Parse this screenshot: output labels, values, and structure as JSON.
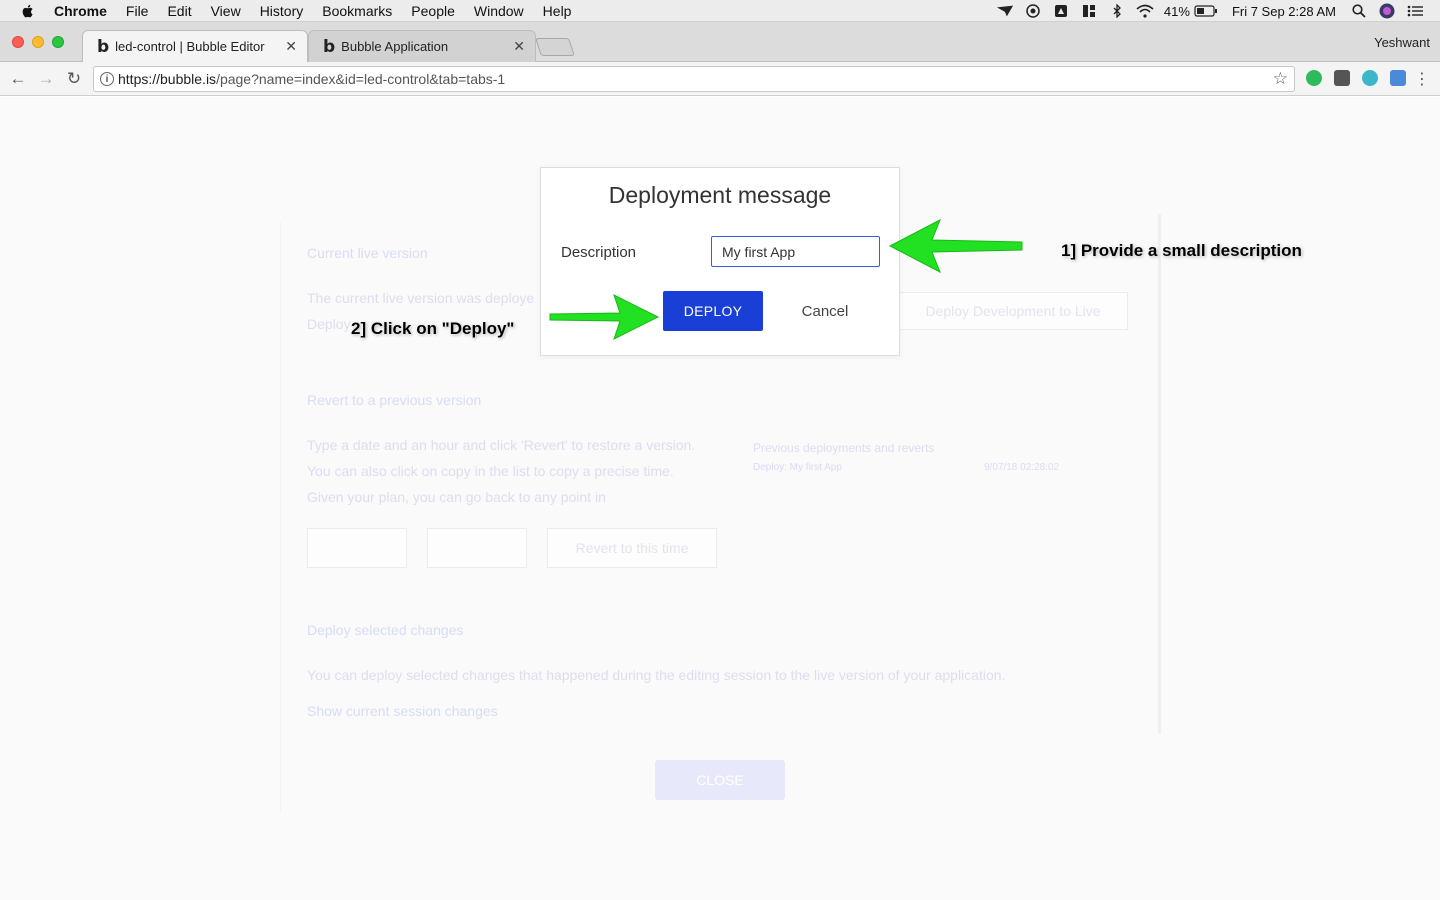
{
  "menubar": {
    "app_name": "Chrome",
    "items": [
      "File",
      "Edit",
      "View",
      "History",
      "Bookmarks",
      "People",
      "Window",
      "Help"
    ],
    "battery": "41%",
    "clock": "Fri 7 Sep  2:28 AM"
  },
  "browser": {
    "tabs": [
      {
        "title": "led-control | Bubble Editor",
        "active": true
      },
      {
        "title": "Bubble Application",
        "active": false
      }
    ],
    "profile": "Yeshwant",
    "url_host": "https://bubble.is",
    "url_path": "/page?name=index&id=led-control&tab=tabs-1"
  },
  "background_page": {
    "current_live_title": "Current live version",
    "current_live_text_1": "The current live version was deploye",
    "current_live_text_2": "Deploy",
    "deploy_dev_btn": "Deploy Development to Live",
    "revert_title": "Revert to a previous version",
    "revert_text_1": "Type a date and an hour and click 'Revert' to restore a version.",
    "revert_text_2": "You can also click on copy in the list to copy a precise time.",
    "revert_text_3": "Given your plan, you can go back to any point in",
    "revert_btn": "Revert to this time",
    "prev_deployments_title": "Previous deployments and reverts",
    "prev_deploy_name": "Deploy: My first App",
    "prev_deploy_time": "9/07/18 02:28:02",
    "deploy_selected_title": "Deploy selected changes",
    "deploy_selected_text": "You can deploy selected changes that happened during the editing session to the live version of your application.",
    "show_changes_link": "Show current session changes",
    "close_btn": "CLOSE"
  },
  "dialog": {
    "title": "Deployment message",
    "description_label": "Description",
    "description_value": "My first App",
    "deploy_label": "DEPLOY",
    "cancel_label": "Cancel"
  },
  "annotations": {
    "step1": "1] Provide a small description",
    "step2": "2] Click on \"Deploy\""
  },
  "colors": {
    "deploy_button": "#1a3fd6",
    "arrow": "#22e022",
    "input_border": "#3b5bdb"
  }
}
